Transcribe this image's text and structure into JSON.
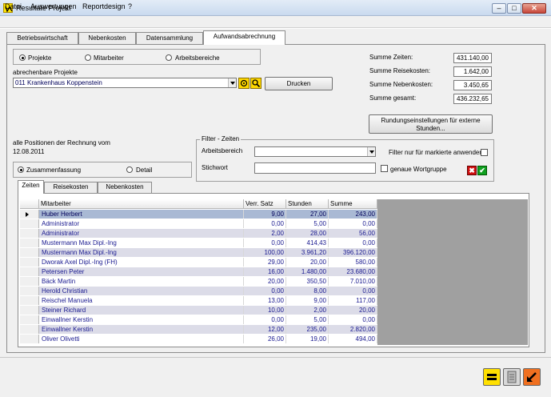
{
  "window": {
    "title": "Resultate Projekt",
    "min": "–",
    "max": "□",
    "close": "✕",
    "icon": "app-logo-icon"
  },
  "menu": {
    "datei": "Datei",
    "auswertungen": "Auswertungen",
    "reportdesign": "Reportdesign",
    "help": "?"
  },
  "tabs": [
    "Betriebswirtschaft",
    "Nebenkosten",
    "Datensammlung",
    "Aufwandsabrechnung"
  ],
  "radios": {
    "projekte": "Projekte",
    "mitarbeiter": "Mitarbeiter",
    "arbeitsbereiche": "Arbeitsbereiche"
  },
  "project": {
    "label": "abrechenbare Projekte",
    "value": "011  Krankenhaus Koppenstein"
  },
  "buttons": {
    "drucken": "Drucken",
    "rundung_line1": "Rundungseinstellungen für externe",
    "rundung_line2": "Stunden..."
  },
  "sums": {
    "zeiten_label": "Summe Zeiten:",
    "zeiten": "431.140,00",
    "reise_label": "Summe Reisekosten:",
    "reise": "1.642,00",
    "neben_label": "Summe Nebenkosten:",
    "neben": "3.450,65",
    "gesamt_label": "Summe gesamt:",
    "gesamt": "436.232,65"
  },
  "positions": {
    "line1": "alle Positionen der Rechnung vom",
    "date": "12.08.2011"
  },
  "filter": {
    "title": "Filter - Zeiten",
    "arbeitsbereich": "Arbeitsbereich",
    "stichwort": "Stichwort",
    "filter_marked": "Filter nur für markierte anwenden",
    "genaue": "genaue Wortgruppe"
  },
  "view": {
    "zusammenfassung": "Zusammenfassung",
    "detail": "Detail"
  },
  "bottom_tabs": [
    "Zeiten",
    "Reisekosten",
    "Nebenkosten"
  ],
  "grid": {
    "headers": [
      "Mitarbeiter",
      "Verr. Satz",
      "Stunden",
      "Summe"
    ],
    "rows": [
      [
        "Huber Herbert",
        "9,00",
        "27,00",
        "243,00"
      ],
      [
        "Administrator",
        "0,00",
        "5,00",
        "0,00"
      ],
      [
        "Administrator",
        "2,00",
        "28,00",
        "56,00"
      ],
      [
        "Mustermann Max Dipl.-Ing",
        "0,00",
        "414,43",
        "0,00"
      ],
      [
        "Mustermann Max Dipl.-Ing",
        "100,00",
        "3.961,20",
        "396.120,00"
      ],
      [
        "Dworak Axel Dipl.-Ing (FH)",
        "29,00",
        "20,00",
        "580,00"
      ],
      [
        "Petersen Peter",
        "16,00",
        "1.480,00",
        "23.680,00"
      ],
      [
        "Bäck Martin",
        "20,00",
        "350,50",
        "7.010,00"
      ],
      [
        "Herold Christian",
        "0,00",
        "8,00",
        "0,00"
      ],
      [
        "Reischel Manuela",
        "13,00",
        "9,00",
        "117,00"
      ],
      [
        "Steiner Richard",
        "10,00",
        "2,00",
        "20,00"
      ],
      [
        "Einwallner Kerstin",
        "0,00",
        "5,00",
        "0,00"
      ],
      [
        "Einwallner Kerstin",
        "12,00",
        "235,00",
        "2.820,00"
      ],
      [
        "Oliver Olivetti",
        "26,00",
        "19,00",
        "494,00"
      ]
    ]
  },
  "icons": {
    "reset": "reset-filter-icon",
    "apply": "apply-filter-icon",
    "cancel": "✖",
    "ok": "✔"
  },
  "colors": {
    "selected_row": "#a9b9d4",
    "alt_row": "#dcdce8",
    "text_blue": "#1a1a90"
  }
}
